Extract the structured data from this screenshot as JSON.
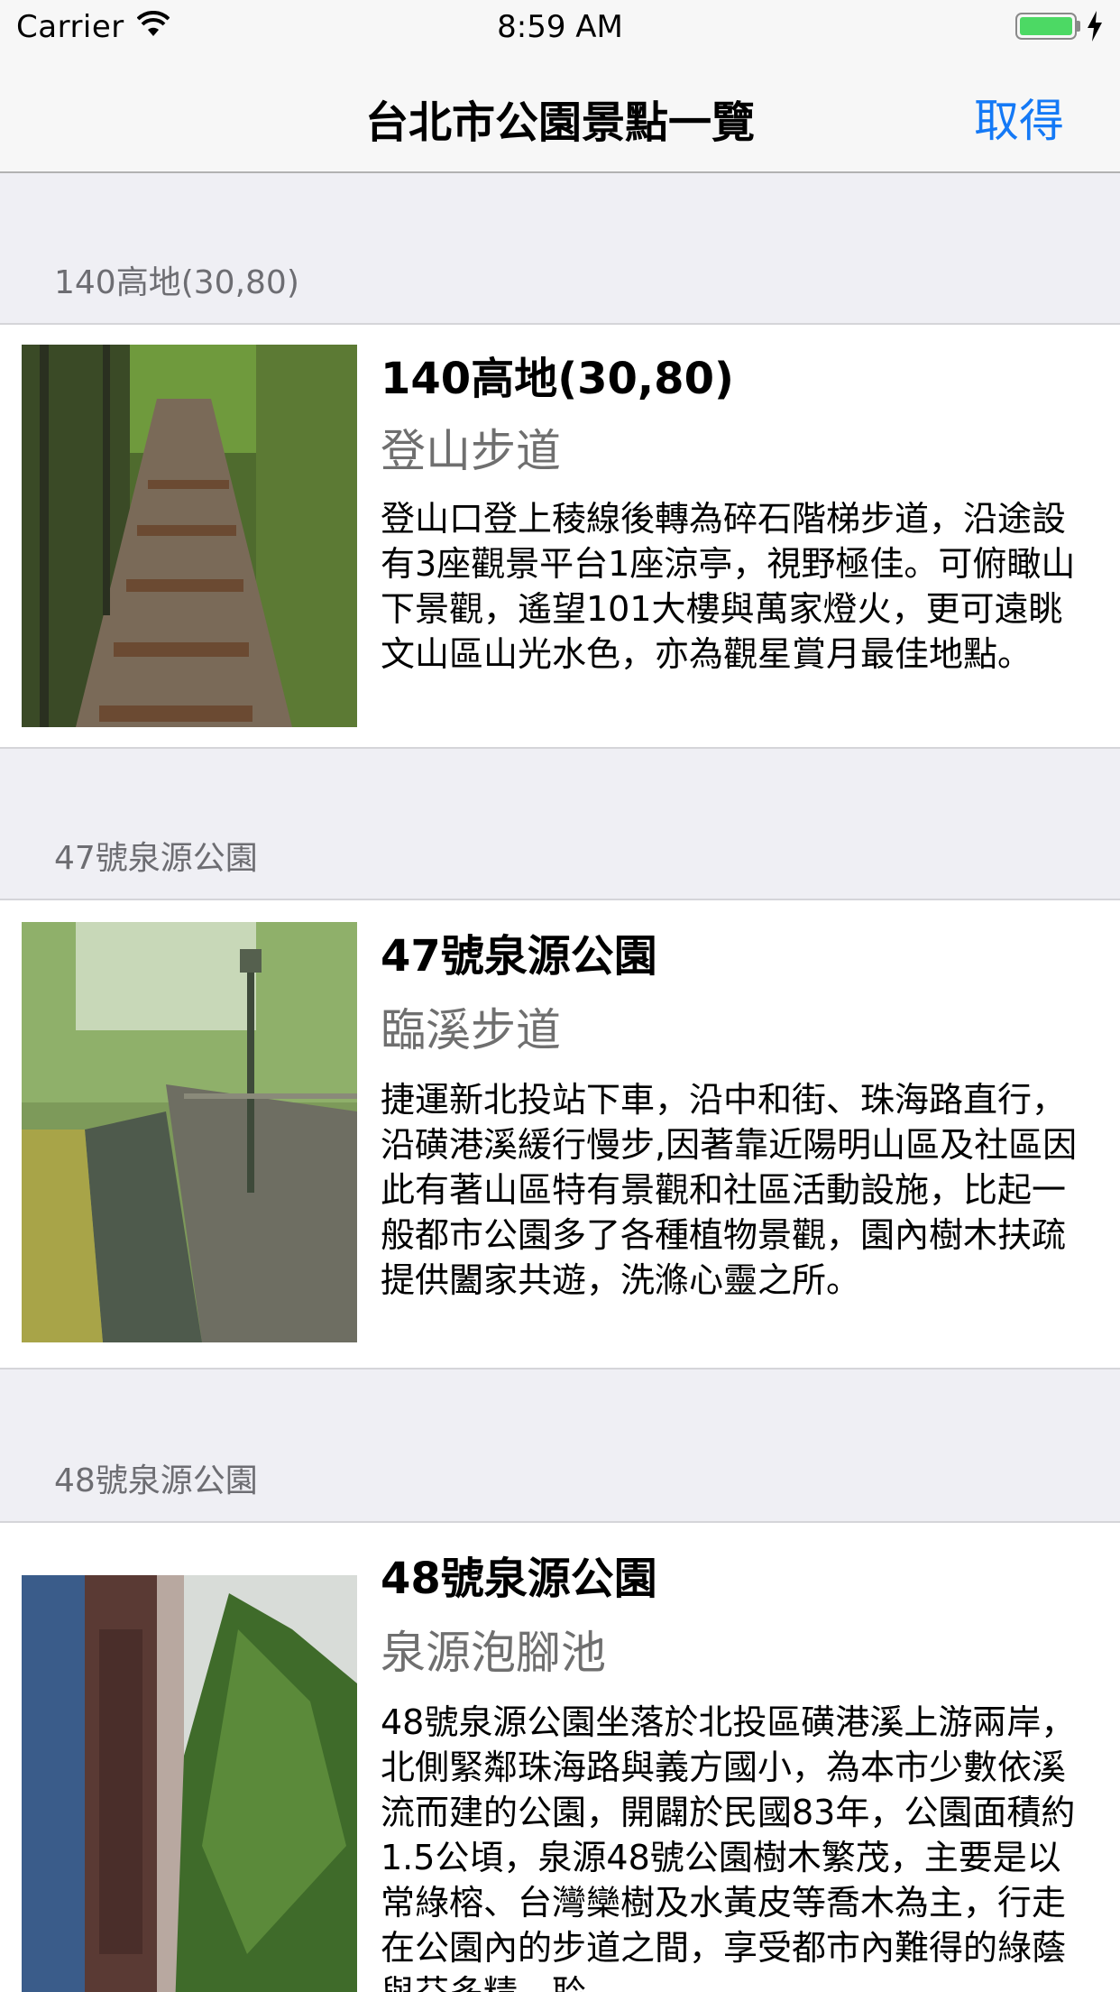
{
  "status_bar": {
    "carrier": "Carrier",
    "time": "8:59 AM",
    "battery_color": "#4cd964"
  },
  "nav": {
    "title": "台北市公園景點一覽",
    "action_label": "取得",
    "action_color": "#1479f6"
  },
  "parks": [
    {
      "section_title": "140高地(30,80)",
      "name": "140高地(30,80)",
      "category": "登山步道",
      "description": "登山口登上稜線後轉為碎石階梯步道，沿途設有3座觀景平台1座涼亭，視野極佳。可俯瞰山下景觀，遙望101大樓與萬家燈火，更可遠眺文山區山光水色，亦為觀星賞月最佳地點。",
      "image": "stone-stair-trail-photo"
    },
    {
      "section_title": "47號泉源公園",
      "name": "47號泉源公園",
      "category": "臨溪步道",
      "description": "捷運新北投站下車，沿中和街、珠海路直行，沿磺港溪緩行慢步,因著靠近陽明山區及社區因此有著山區特有景觀和社區活動設施，比起一般都市公園多了各種植物景觀，園內樹木扶疏提供闔家共遊，洗滌心靈之所。",
      "image": "stream-walkway-photo"
    },
    {
      "section_title": "48號泉源公園",
      "name": "48號泉源公園",
      "category": "泉源泡腳池",
      "description": "48號泉源公園坐落於北投區磺港溪上游兩岸，北側緊鄰珠海路與義方國小，為本市少數依溪流而建的公園，開闢於民國83年，公園面積約1.5公頃，泉源48號公園樹木繁茂，主要是以常綠榕、台灣欒樹及水黃皮等喬木為主，行走在公園內的步道之間，享受都市內難得的綠蔭與芬多精，聆",
      "image": "park-sign-and-tree-photo"
    }
  ]
}
